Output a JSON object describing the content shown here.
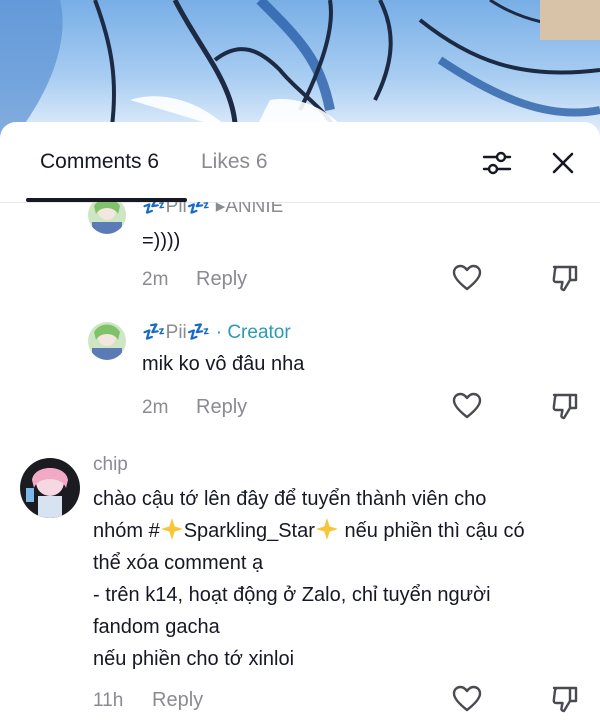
{
  "tabs": {
    "comments": "Comments 6",
    "likes": "Likes 6"
  },
  "icons": {
    "filter": "sliders-icon",
    "close": "close-icon",
    "like": "heart-icon",
    "dislike": "thumbs-down-icon"
  },
  "comments": [
    {
      "name": "💤Pii💤 ▸ANNIE",
      "text": "=))))",
      "time": "2m",
      "reply": "Reply"
    },
    {
      "name": "💤Pii💤",
      "badge": "· Creator",
      "text": "mik ko vô đâu nha",
      "time": "2m",
      "reply": "Reply"
    },
    {
      "name": "chip",
      "lines": [
        "chào cậu tớ lên đây để tuyển thành viên cho",
        "nhóm #",
        "Sparkling_Star",
        " nếu phiền thì cậu có",
        "thể xóa comment ạ",
        "- trên k14, hoạt động ở Zalo, chỉ tuyển người",
        "fandom gacha",
        "nếu phiền cho tớ xinloi"
      ],
      "time": "11h",
      "reply": "Reply"
    }
  ],
  "colors": {
    "creator": "#2b9ab5",
    "muted": "#8a8b91",
    "text": "#161823",
    "star": "#f7c637"
  }
}
